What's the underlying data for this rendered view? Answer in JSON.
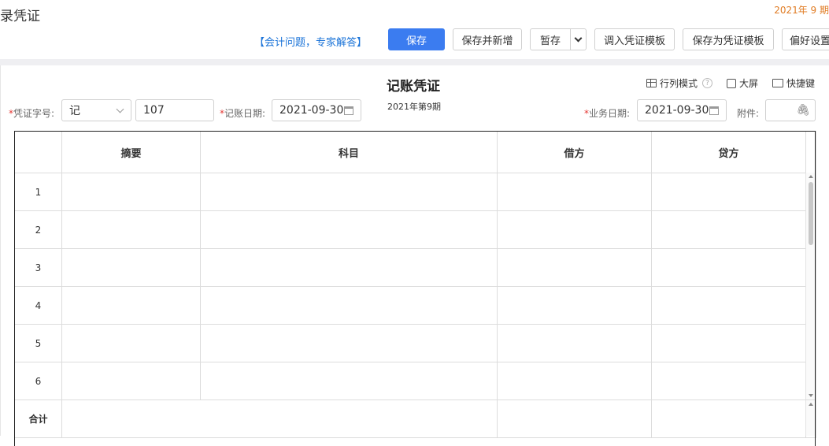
{
  "header": {
    "title": "录凭证",
    "period": "2021年 9 期"
  },
  "toolbar": {
    "expert_link": "【会计问题，专家解答】",
    "save": "保存",
    "save_new": "保存并新增",
    "draft": "暂存",
    "import_template": "调入凭证模板",
    "save_template": "保存为凭证模板",
    "preferences": "偏好设置"
  },
  "voucher": {
    "title": "记账凭证",
    "period": "2021年第9期",
    "view_modes": {
      "row_col": "行列模式",
      "fullscreen": "大屏",
      "shortcut": "快捷键"
    },
    "fields": {
      "word_label": "凭证字号:",
      "word_value": "记",
      "number_value": "107",
      "date_label": "记账日期:",
      "date_value": "2021-09-30",
      "biz_date_label": "业务日期:",
      "biz_date_value": "2021-09-30",
      "attachment_label": "附件:"
    }
  },
  "table": {
    "headers": [
      "摘要",
      "科目",
      "借方",
      "贷方"
    ],
    "rows": [
      "1",
      "2",
      "3",
      "4",
      "5",
      "6"
    ],
    "total_label": "合计"
  }
}
